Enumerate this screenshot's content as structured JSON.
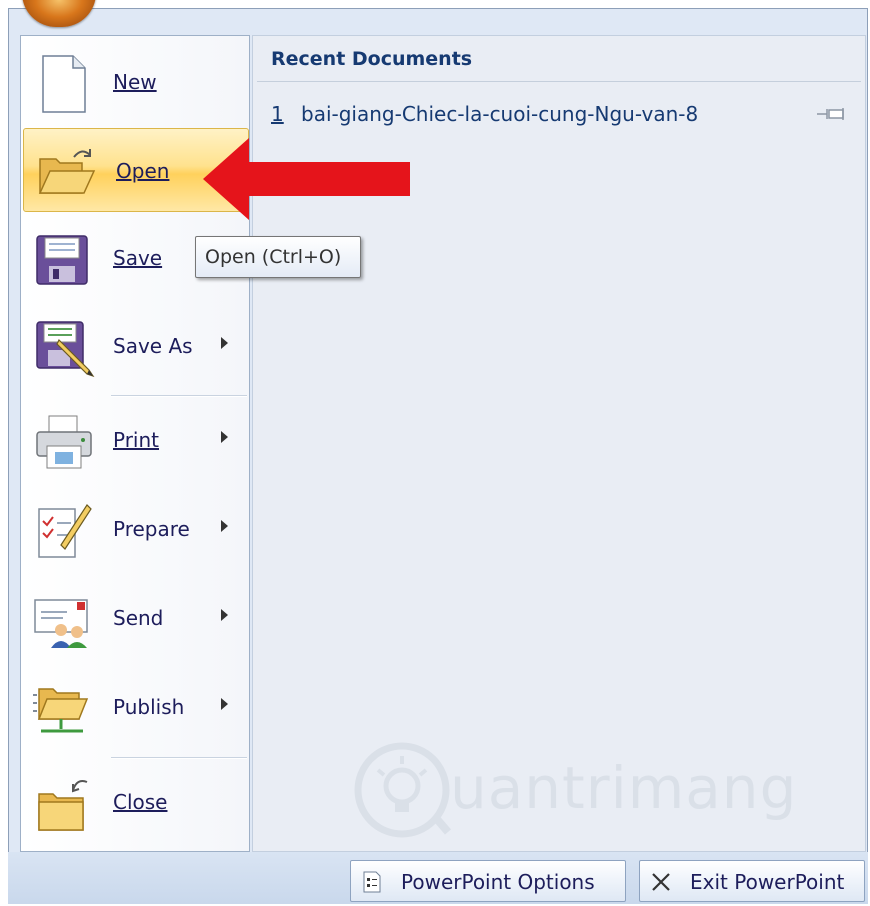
{
  "menu": {
    "items": [
      {
        "label": "New"
      },
      {
        "label": "Open"
      },
      {
        "label": "Save"
      },
      {
        "label": "Save As"
      },
      {
        "label": "Print"
      },
      {
        "label": "Prepare"
      },
      {
        "label": "Send"
      },
      {
        "label": "Publish"
      },
      {
        "label": "Close"
      }
    ]
  },
  "recent": {
    "title": "Recent Documents",
    "items": [
      {
        "number": "1",
        "name": "bai-giang-Chiec-la-cuoi-cung-Ngu-van-8"
      }
    ]
  },
  "tooltip": {
    "text": "Open (Ctrl+O)"
  },
  "footer": {
    "options_label": "PowerPoint Options",
    "exit_label": "Exit PowerPoint"
  },
  "watermark": {
    "text": "uantrimang"
  },
  "colors": {
    "highlight": "#ffd15c",
    "arrow": "#e5141b",
    "link_text": "#163a72"
  }
}
